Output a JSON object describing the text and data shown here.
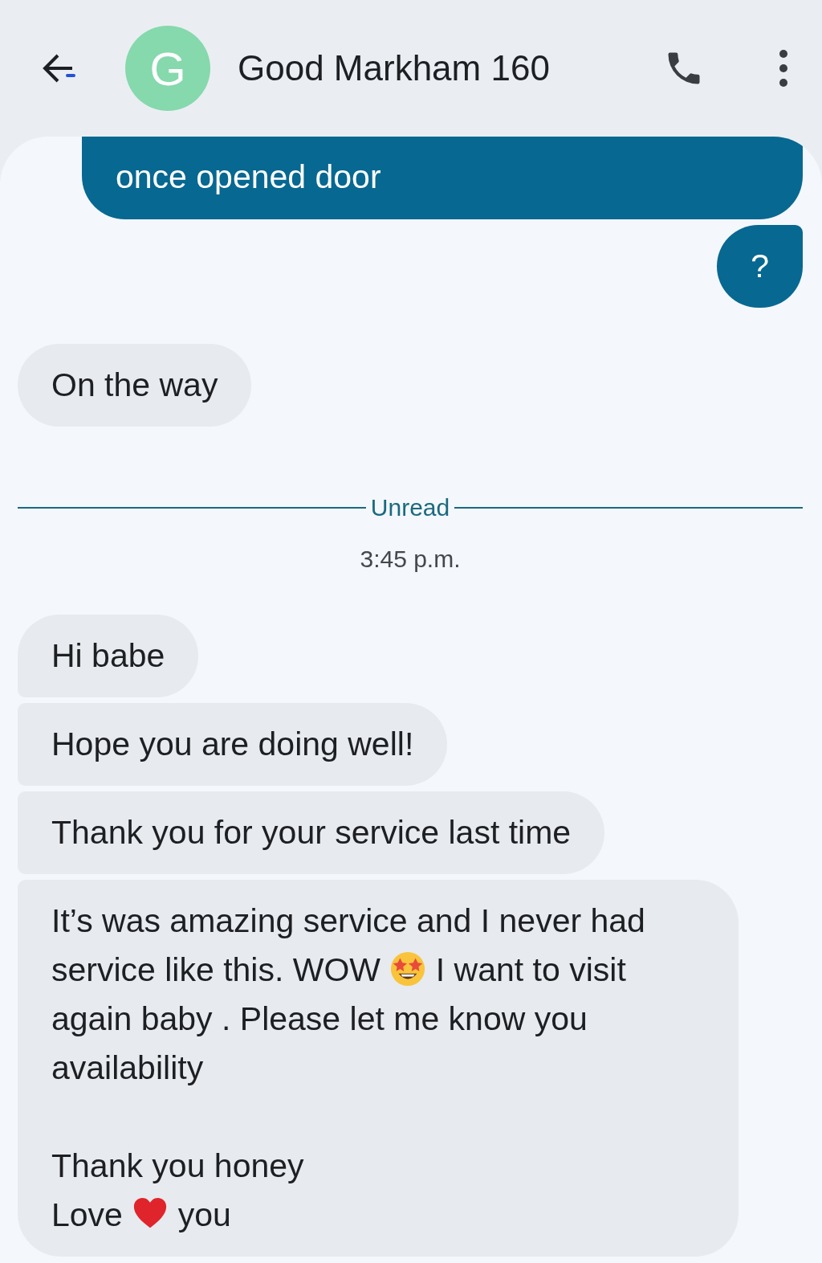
{
  "header": {
    "avatar_letter": "G",
    "title": "Good Markham 160"
  },
  "messages": [
    {
      "kind": "sent",
      "parts": [
        {
          "kind": "text",
          "text": "once opened door"
        }
      ]
    },
    {
      "kind": "sent",
      "parts": [
        {
          "kind": "text",
          "text": "?"
        }
      ]
    },
    {
      "kind": "received",
      "parts": [
        {
          "kind": "text",
          "text": "On the way"
        }
      ]
    },
    {
      "kind": "divider",
      "text": "Unread"
    },
    {
      "kind": "time",
      "text": "3:45 p.m."
    },
    {
      "kind": "received",
      "parts": [
        {
          "kind": "text",
          "text": "Hi babe"
        }
      ]
    },
    {
      "kind": "received",
      "parts": [
        {
          "kind": "text",
          "text": "Hope you are doing well!"
        }
      ]
    },
    {
      "kind": "received",
      "parts": [
        {
          "kind": "text",
          "text": "Thank you for your service last time"
        }
      ]
    },
    {
      "kind": "received",
      "parts": [
        {
          "kind": "text",
          "text": "It’s was amazing service and I never had service like this. WOW "
        },
        {
          "kind": "emoji-star"
        },
        {
          "kind": "text",
          "text": " I want to visit again baby . Please let me know you availability\n\nThank you honey\nLove "
        },
        {
          "kind": "emoji-heart"
        },
        {
          "kind": "text",
          "text": " you"
        }
      ]
    }
  ]
}
